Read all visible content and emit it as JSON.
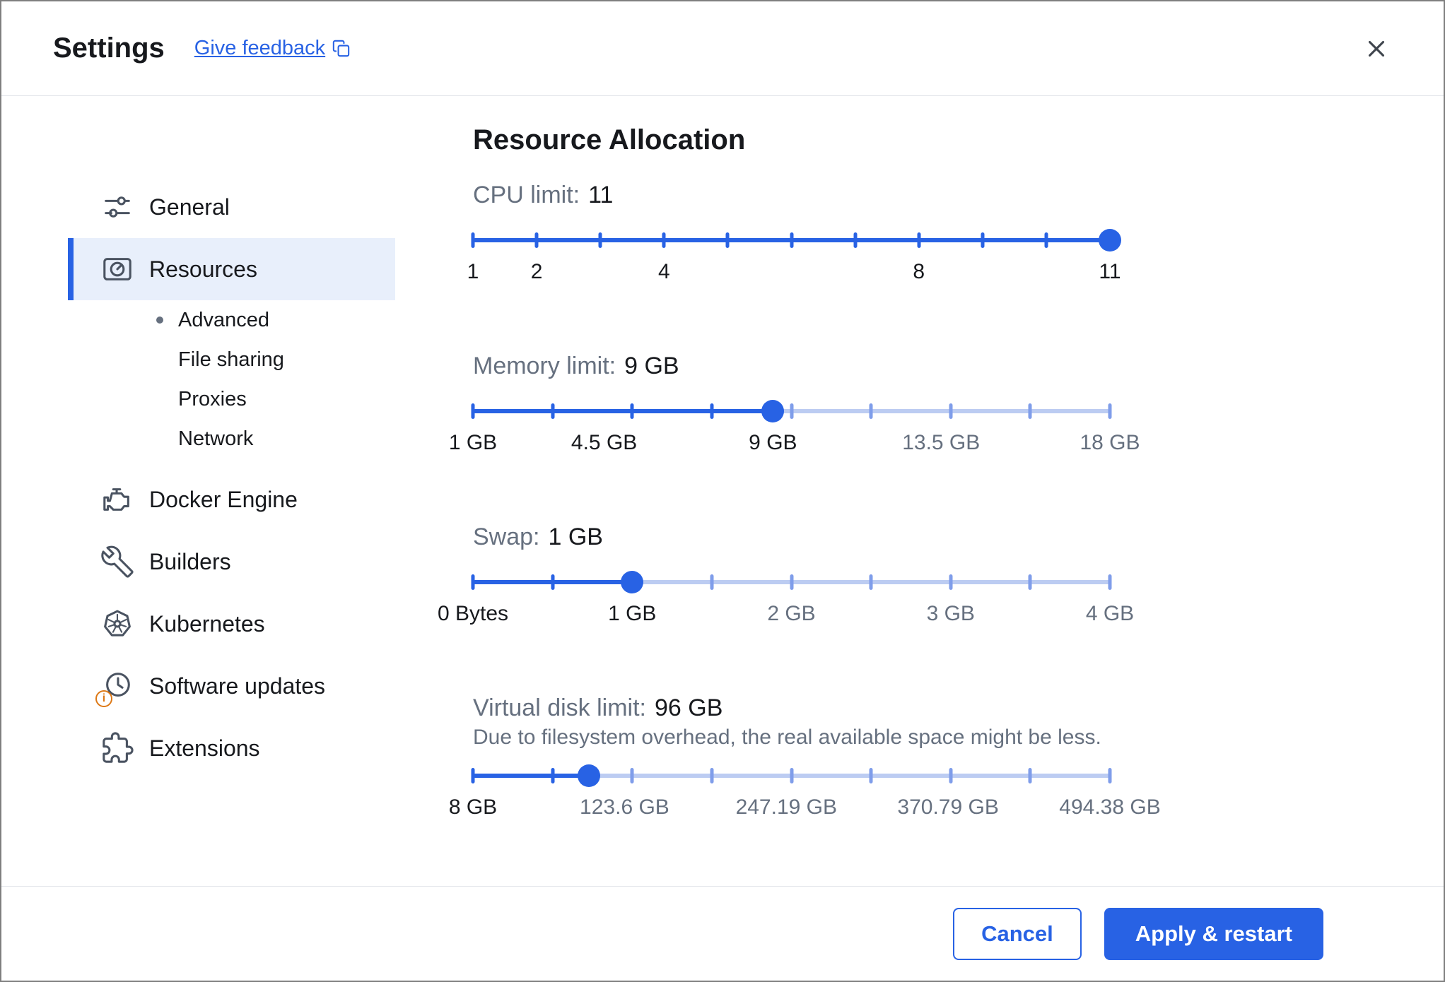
{
  "colors": {
    "accent": "#2862e4",
    "track_inactive": "#bcccf2",
    "tick_inactive": "#7f9dea",
    "selected_bg": "#e8effb",
    "text_dark": "#17191d",
    "text_muted": "#66707f",
    "badge_orange": "#dd7815"
  },
  "header": {
    "title": "Settings",
    "feedback_label": "Give feedback"
  },
  "sidebar": {
    "items": [
      {
        "label": "General",
        "icon": "tune-icon"
      },
      {
        "label": "Resources",
        "icon": "gauge-icon",
        "selected": true,
        "children": [
          {
            "label": "Advanced",
            "active": true
          },
          {
            "label": "File sharing",
            "active": false
          },
          {
            "label": "Proxies",
            "active": false
          },
          {
            "label": "Network",
            "active": false
          }
        ]
      },
      {
        "label": "Docker Engine",
        "icon": "engine-icon"
      },
      {
        "label": "Builders",
        "icon": "wrench-icon"
      },
      {
        "label": "Kubernetes",
        "icon": "kubernetes-wheel-icon"
      },
      {
        "label": "Software updates",
        "icon": "clock-update-icon",
        "badge": "i"
      },
      {
        "label": "Extensions",
        "icon": "puzzle-icon"
      }
    ]
  },
  "main": {
    "title": "Resource Allocation"
  },
  "sliders": [
    {
      "name": "cpu",
      "label": "CPU limit:",
      "value": "11",
      "handle_pct": 100,
      "ticks_pct": [
        0,
        10,
        20,
        30,
        40,
        50,
        60,
        70,
        80,
        90,
        100
      ],
      "labels": [
        {
          "text": "1",
          "pct": 0
        },
        {
          "text": "2",
          "pct": 10
        },
        {
          "text": "4",
          "pct": 30
        },
        {
          "text": "8",
          "pct": 70
        },
        {
          "text": "11",
          "pct": 100
        }
      ]
    },
    {
      "name": "memory",
      "label": "Memory limit:",
      "value": "9 GB",
      "handle_pct": 47.1,
      "ticks_pct": [
        0,
        12.5,
        25,
        37.5,
        50,
        62.5,
        75,
        87.5,
        100
      ],
      "labels": [
        {
          "text": "1 GB",
          "pct": 0
        },
        {
          "text": "4.5 GB",
          "pct": 20.6
        },
        {
          "text": "9 GB",
          "pct": 47.1
        },
        {
          "text": "13.5 GB",
          "pct": 73.5
        },
        {
          "text": "18 GB",
          "pct": 100
        }
      ]
    },
    {
      "name": "swap",
      "label": "Swap:",
      "value": "1 GB",
      "handle_pct": 25,
      "ticks_pct": [
        0,
        12.5,
        25,
        37.5,
        50,
        62.5,
        75,
        87.5,
        100
      ],
      "labels": [
        {
          "text": "0 Bytes",
          "pct": 0
        },
        {
          "text": "1 GB",
          "pct": 25
        },
        {
          "text": "2 GB",
          "pct": 50
        },
        {
          "text": "3 GB",
          "pct": 75
        },
        {
          "text": "4 GB",
          "pct": 100
        }
      ]
    },
    {
      "name": "virtual-disk",
      "label": "Virtual disk limit:",
      "value": "96 GB",
      "note": "Due to filesystem overhead, the real available space might be less.",
      "handle_pct": 18.2,
      "ticks_pct": [
        0,
        12.5,
        25,
        37.5,
        50,
        62.5,
        75,
        87.5,
        100
      ],
      "labels": [
        {
          "text": "8 GB",
          "pct": 0
        },
        {
          "text": "123.6 GB",
          "pct": 23.8
        },
        {
          "text": "247.19 GB",
          "pct": 49.2
        },
        {
          "text": "370.79 GB",
          "pct": 74.6
        },
        {
          "text": "494.38 GB",
          "pct": 100
        }
      ]
    }
  ],
  "footer": {
    "cancel_label": "Cancel",
    "apply_label": "Apply & restart"
  }
}
